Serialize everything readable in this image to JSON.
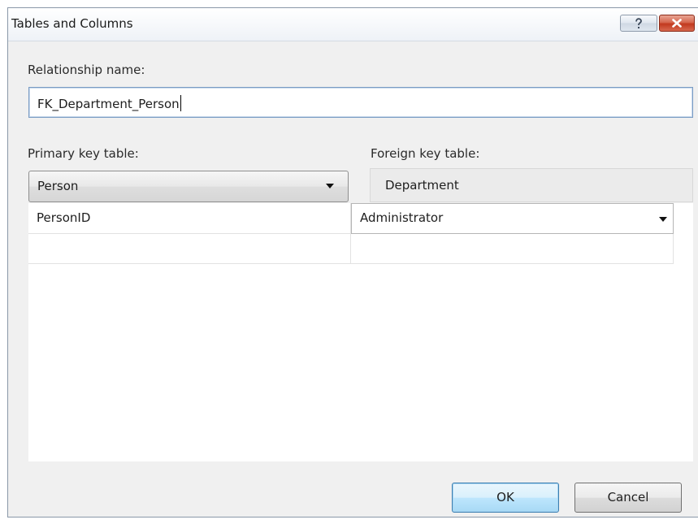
{
  "dialog": {
    "title": "Tables and Columns"
  },
  "relationship": {
    "label": "Relationship name:",
    "value": "FK_Department_Person"
  },
  "primary_key": {
    "label": "Primary key table:",
    "selected": "Person"
  },
  "foreign_key": {
    "label": "Foreign key table:",
    "value": "Department"
  },
  "columns": {
    "rows": [
      {
        "primary": "PersonID",
        "foreign": "Administrator"
      },
      {
        "primary": "",
        "foreign": ""
      }
    ]
  },
  "buttons": {
    "ok": "OK",
    "cancel": "Cancel"
  },
  "icons": {
    "help": "help-icon",
    "close": "close-icon",
    "dropdown": "chevron-down-icon"
  }
}
